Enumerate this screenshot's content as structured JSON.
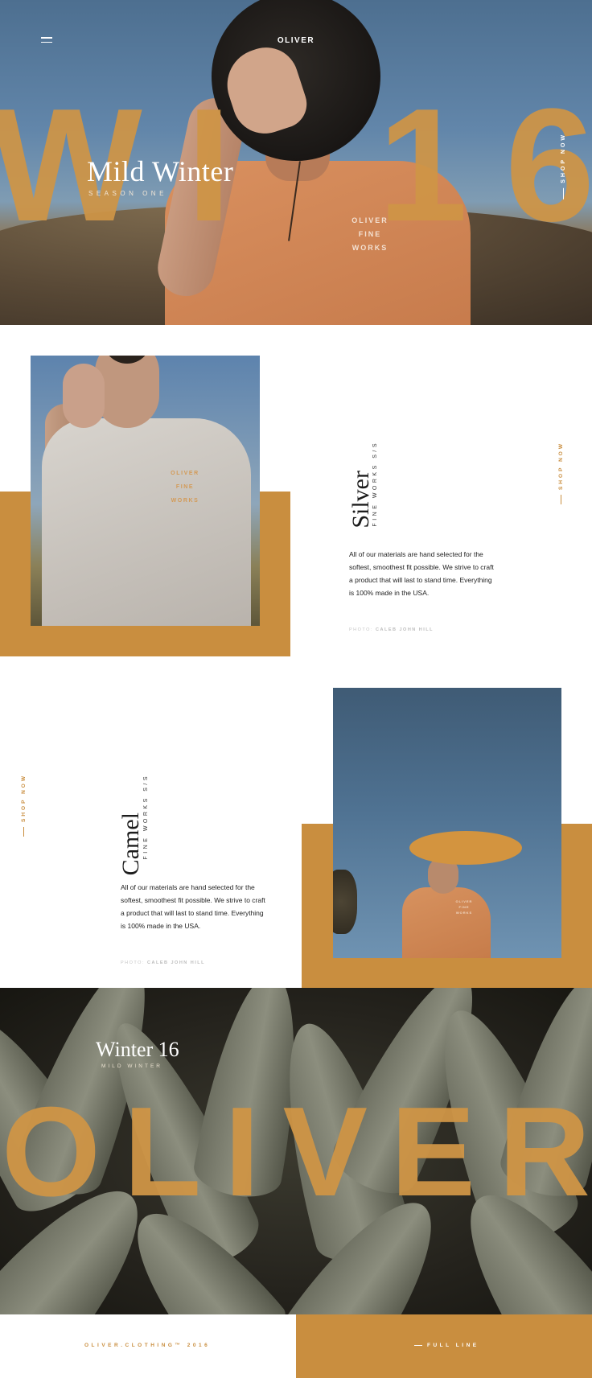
{
  "header": {
    "brand": "OLIVER",
    "menu_icon": "hamburger-menu-icon"
  },
  "hero": {
    "big_letters": [
      "W",
      "I",
      "1",
      "6"
    ],
    "title": "Mild Winter",
    "subtitle": "SEASON ONE",
    "shop_label": "SHOP NOW",
    "shirt_print": [
      "OLIVER",
      "FINE",
      "WORKS"
    ]
  },
  "silver": {
    "title": "Silver",
    "subtitle": "FINE WORKS S/S",
    "body": "All of our materials are hand selected for the softest, smoothest fit possible. We strive to craft a product that will last to stand time. Everything is 100% made in the USA.",
    "credit_label": "PHOTO:",
    "credit_name": "CALEB JOHN HILL",
    "shop_label": "SHOP NOW",
    "shirt_print": [
      "OLIVER",
      "FINE",
      "WORKS"
    ]
  },
  "camel": {
    "title": "Camel",
    "subtitle": "FINE WORKS S/S",
    "body": "All of our materials are hand selected for the softest, smoothest fit possible. We strive to craft a product that will last to stand time. Everything is 100% made in the USA.",
    "credit_label": "PHOTO:",
    "credit_name": "CALEB JOHN HILL",
    "shop_label": "SHOP NOW"
  },
  "winter": {
    "title": "Winter 16",
    "subtitle": "MILD WINTER",
    "big_letters": [
      "O",
      "L",
      "I",
      "V",
      "E",
      "R"
    ]
  },
  "footer": {
    "copyright": "OLIVER.CLOTHING™ 2016",
    "link": "FULL LINE"
  },
  "colors": {
    "accent": "#c98e3f",
    "text": "#1c1c1c",
    "background": "#ffffff"
  }
}
